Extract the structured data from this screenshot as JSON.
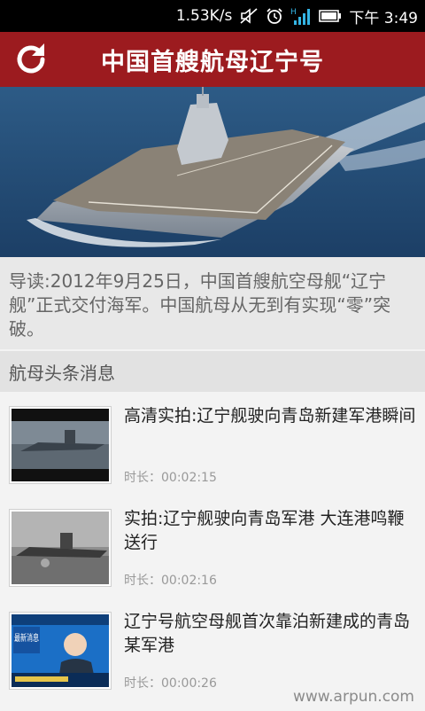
{
  "status_bar": {
    "speed": "1.53K/s",
    "time": "下午 3:49",
    "icons": [
      "no-sound-icon",
      "alarm-icon",
      "signal-icon",
      "battery-icon"
    ]
  },
  "header": {
    "title": "中国首艘航母辽宁号",
    "refresh_icon": "refresh-icon",
    "bg_color": "#9c1b1f"
  },
  "intro": {
    "text": "导读:2012年9月25日，中国首艘航空母舰“辽宁舰”正式交付海军。中国航母从无到有实现“零”突破。"
  },
  "section": {
    "title": "航母头条消息"
  },
  "news": [
    {
      "title": "高清实拍:辽宁舰驶向青岛新建军港瞬间",
      "duration": "时长：00:02:15"
    },
    {
      "title": "实拍:辽宁舰驶向青岛军港 大连港鸣鞭送行",
      "duration": "时长：00:02:16"
    },
    {
      "title": "辽宁号航空母舰首次靠泊新建成的青岛某军港",
      "duration": "时长：00:00:26",
      "thumb_text": "最新消息"
    }
  ],
  "watermark": "www.arpun.com"
}
